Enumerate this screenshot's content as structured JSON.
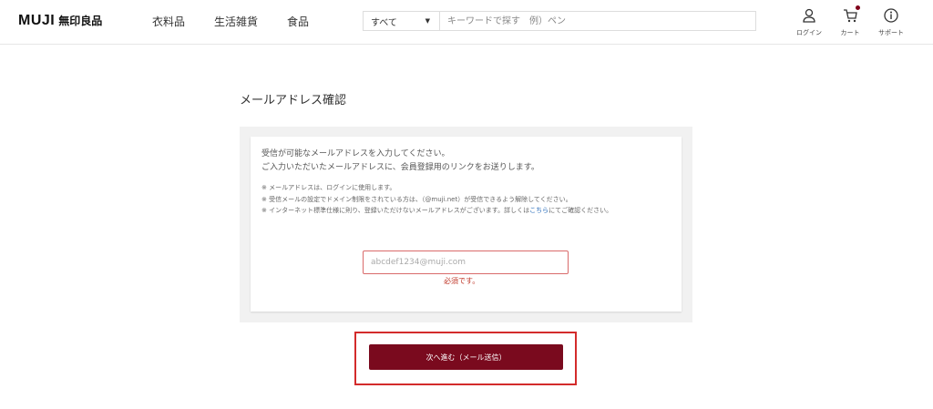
{
  "header": {
    "brand": "MUJI",
    "brand_jp": "無印良品",
    "nav": [
      "衣料品",
      "生活雑貨",
      "食品"
    ],
    "search": {
      "category": "すべて",
      "placeholder": "キーワードで探す　例）ペン"
    },
    "utility": {
      "login": "ログイン",
      "cart": "カート",
      "support": "サポート"
    }
  },
  "main": {
    "title": "メールアドレス確認",
    "intro": [
      "受信が可能なメールアドレスを入力してください。",
      "ご入力いただいたメールアドレスに、会員登録用のリンクをお送りします。"
    ],
    "notes": {
      "n1": "※ メールアドレスは、ログインに使用します。",
      "n2": "※ 受信メールの設定でドメイン制限をされている方は、（@muji.net）が受信できるよう解除してください。",
      "n3_pre": "※ インターネット標準仕様に則り、登録いただけないメールアドレスがございます。詳しくは",
      "n3_link": "こちら",
      "n3_post": "にてご確認ください。"
    },
    "email_placeholder": "abcdef1234@muji.com",
    "error": "必須です。",
    "submit": "次へ進む（メール送信）"
  },
  "colors": {
    "accent": "#7a0a1e",
    "error": "#c0392b",
    "highlight": "#d32b2b",
    "link": "#2a6ebb"
  }
}
